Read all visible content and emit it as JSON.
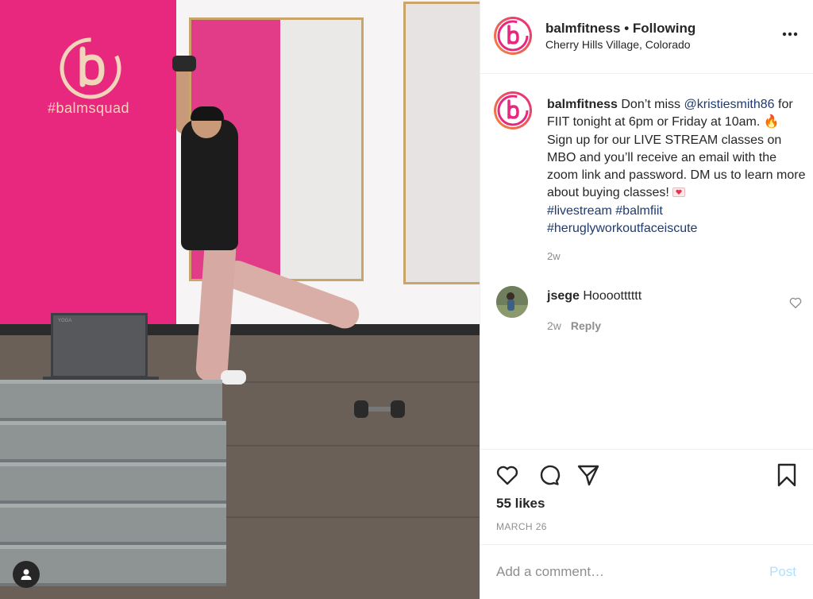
{
  "photo": {
    "wall_logo_text": "#balmsquad",
    "laptop_brand": "YOGA",
    "user_tag_icon": "person-icon"
  },
  "header": {
    "username": "balmfitness",
    "separator": "•",
    "follow_status": "Following",
    "location": "Cherry Hills Village, Colorado",
    "more_icon": "more-options-icon"
  },
  "caption": {
    "username": "balmfitness",
    "text_1": " Don’t miss ",
    "mention": "@kristiesmith86",
    "text_2": " for FIIT tonight at 6pm or Friday at 10am. ",
    "fire_emoji": "🔥",
    "text_3": " Sign up for our LIVE STREAM classes on MBO and you’ll receive an email with the zoom link and password. DM us to learn more about buying classes! ",
    "heart_emoji_icon": "love-letter-icon",
    "hashtag_1": "#livestream",
    "hashtag_2": "#balmfiit",
    "hashtag_3": "#heruglyworkoutfaceiscute",
    "time": "2w"
  },
  "comment": {
    "username": "jsege",
    "text": "Hooootttttt",
    "time": "2w",
    "reply_label": "Reply",
    "like_icon": "heart-outline-icon"
  },
  "actions": {
    "like_icon": "heart-outline-icon",
    "comment_icon": "comment-bubble-icon",
    "share_icon": "paper-plane-icon",
    "save_icon": "bookmark-icon",
    "likes": "55 likes",
    "date": "MARCH 26"
  },
  "comment_box": {
    "placeholder": "Add a comment…",
    "post_label": "Post"
  },
  "colors": {
    "brand_pink": "#e8287e",
    "brand_orange": "#f28a3a",
    "link_blue": "#1f3b6e",
    "post_disabled": "#b2dffc",
    "muted_text": "#8e8e8e"
  }
}
